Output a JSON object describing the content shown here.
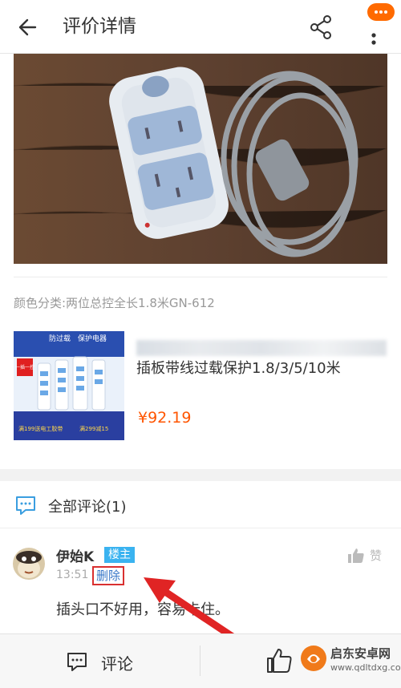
{
  "header": {
    "title": "评价详情",
    "back_icon": "back-arrow-icon",
    "share_icon": "share-icon",
    "more_icon": "more-vertical-icon"
  },
  "review": {
    "sku_text": "颜色分类:两位总控全长1.8米GN-612"
  },
  "product": {
    "title_line2": "插板带线过载保护1.8/3/5/10米",
    "price": "¥92.19",
    "thumb_text": {
      "badge": "一插一控",
      "headline_1": "防过载",
      "headline_2": "保护电器",
      "promo_1": "满199送电工胶带",
      "promo_2": "满299减15"
    }
  },
  "comments": {
    "header_label": "全部评论(1)",
    "items": [
      {
        "user": "伊始K",
        "badge": "楼主",
        "time": "13:51",
        "delete_label": "删除",
        "like_label": "赞",
        "text": "插头口不好用，容易卡住。"
      }
    ]
  },
  "bottom_bar": {
    "comment_label": "评论",
    "like_icon": "thumbs-up-icon"
  },
  "watermark": {
    "name": "启东安卓网",
    "url": "www.qdltdxg.com"
  },
  "colors": {
    "price": "#ff5500",
    "owner_badge": "#3ab3f0",
    "delete_border": "#d93030",
    "delete_text": "#3a78c8",
    "notify": "#ff6a00"
  }
}
